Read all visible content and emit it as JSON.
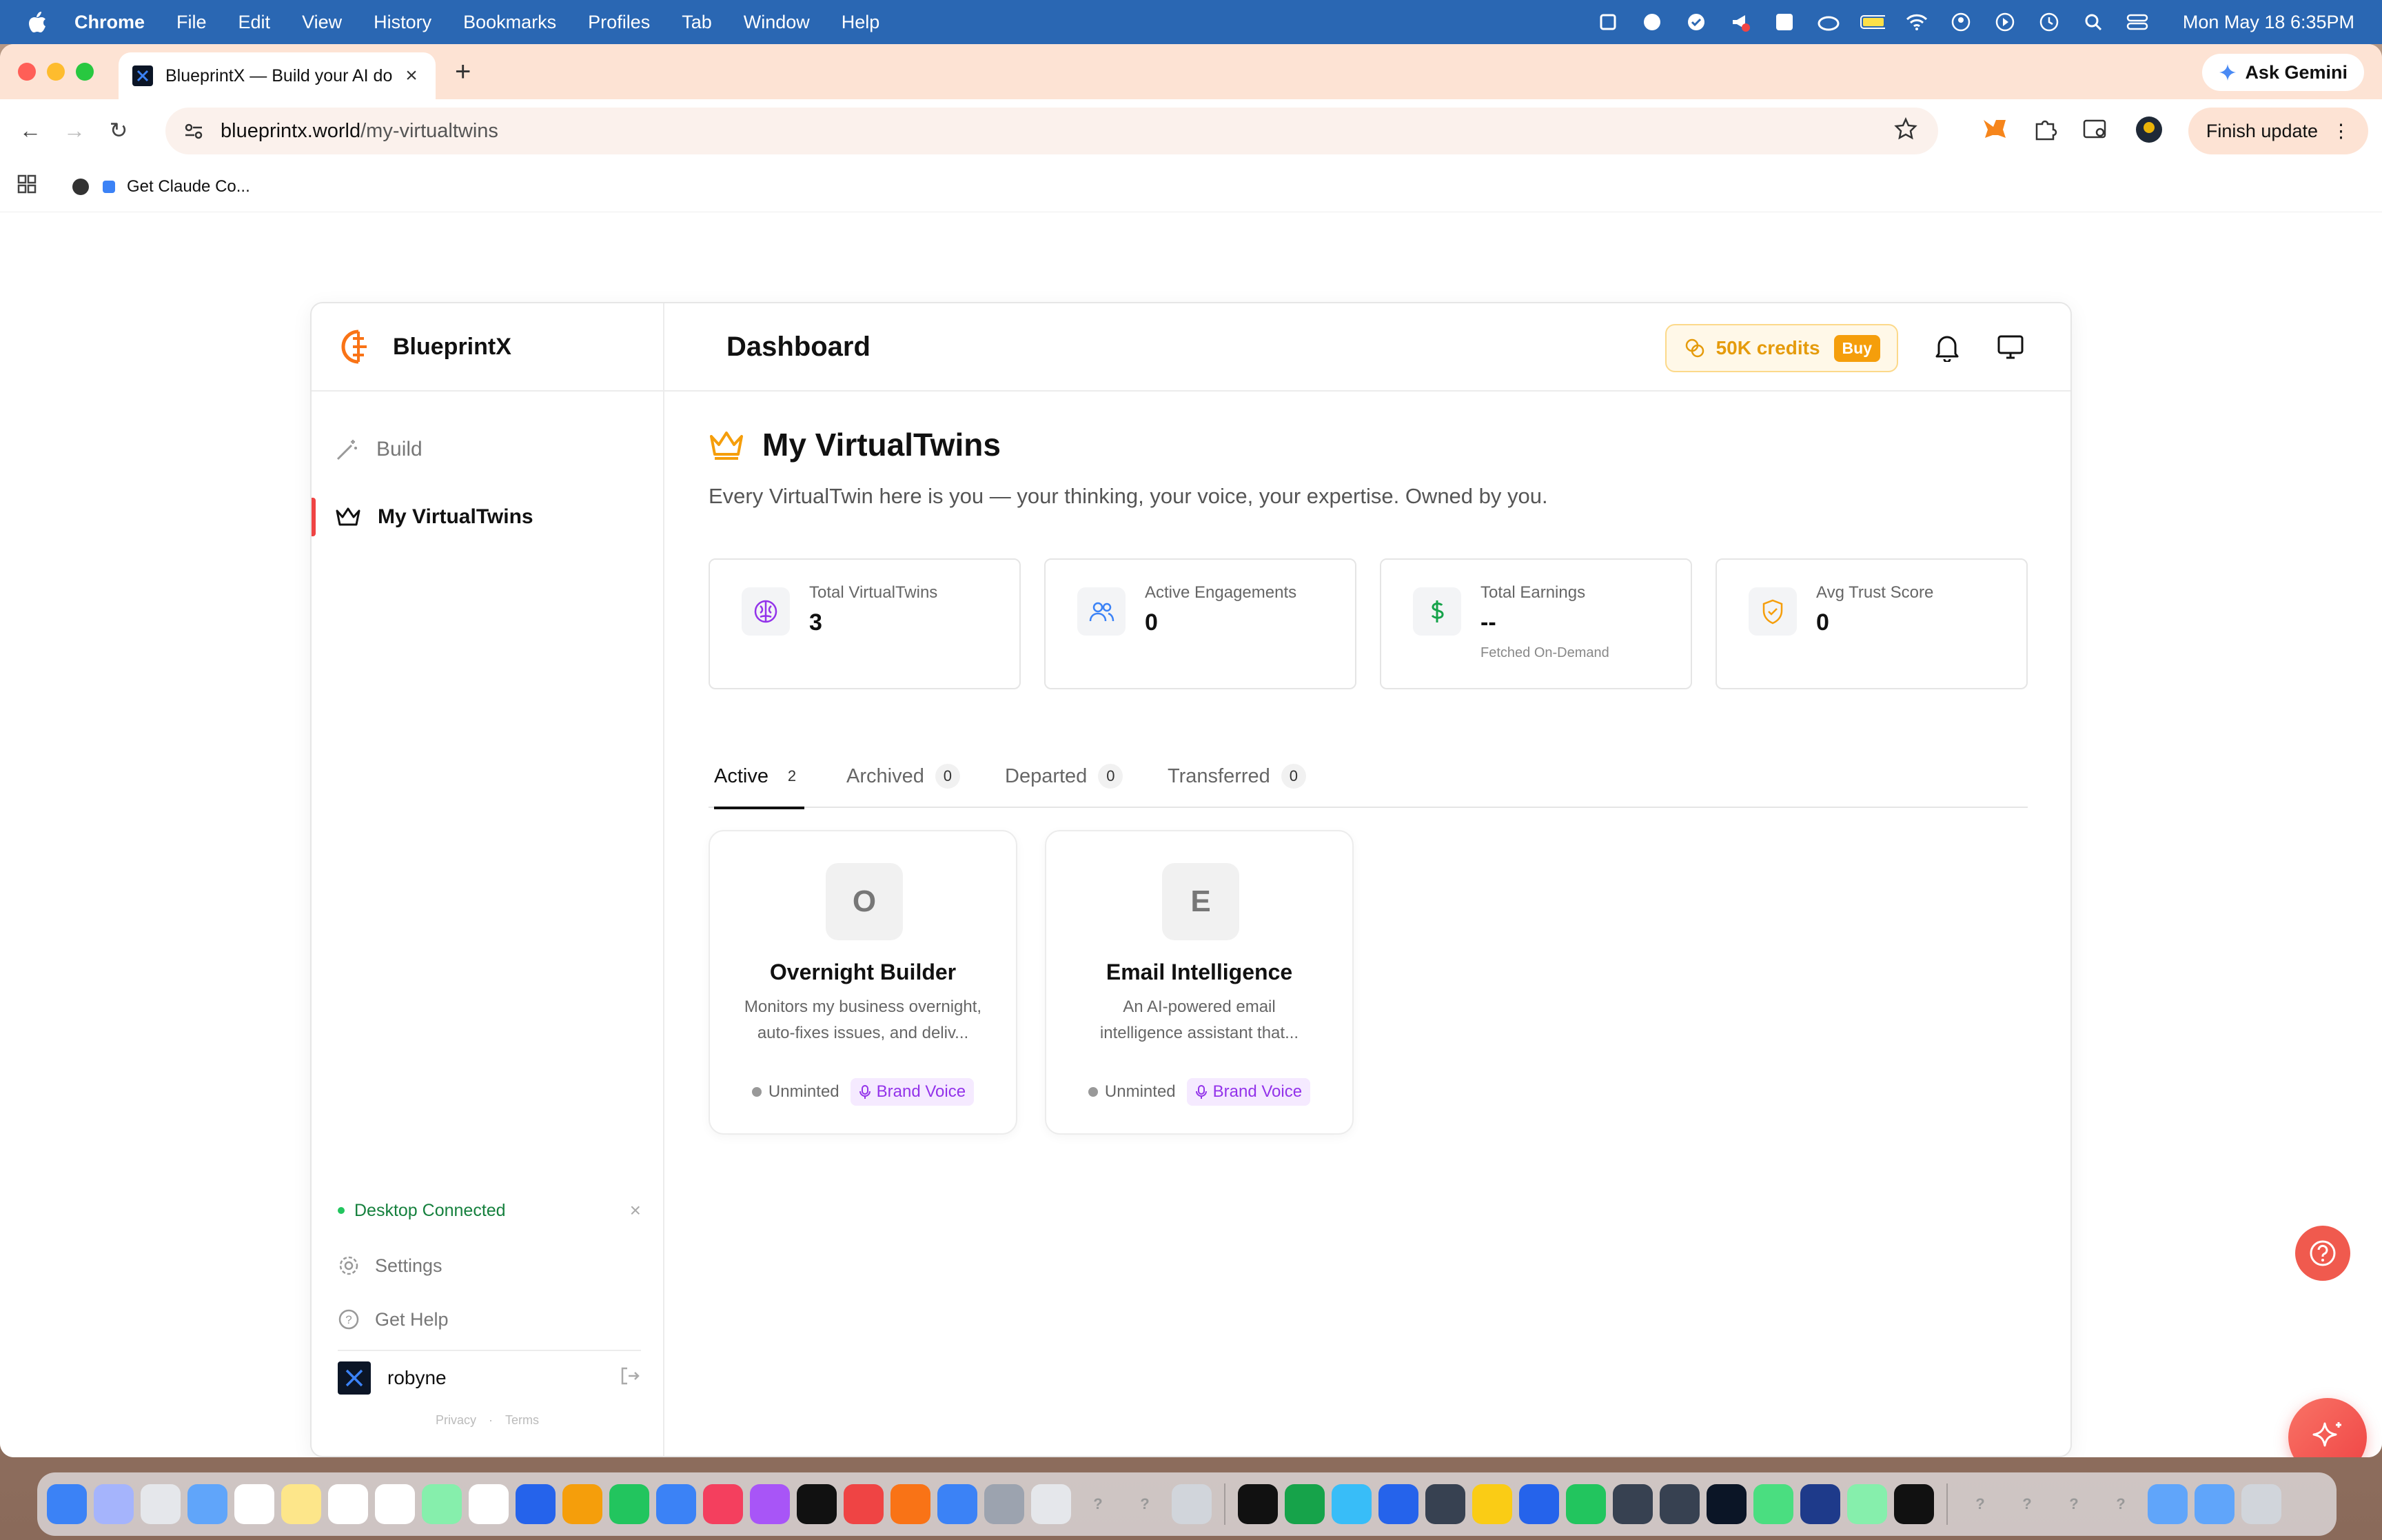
{
  "menubar": {
    "app": "Chrome",
    "items": [
      "File",
      "Edit",
      "View",
      "History",
      "Bookmarks",
      "Profiles",
      "Tab",
      "Window",
      "Help"
    ],
    "clock": "Mon May 18  6:35PM"
  },
  "browser": {
    "tab_title": "BlueprintX — Build your AI do",
    "ask_gemini": "Ask Gemini",
    "url_host": "blueprintx.world",
    "url_path": "/my-virtualtwins",
    "finish_update": "Finish update",
    "bookmark": "Get Claude Co..."
  },
  "app": {
    "brand": "BlueprintX",
    "header_title": "Dashboard",
    "credits": "50K credits",
    "buy": "Buy",
    "colors": {
      "accent": "#ef4444",
      "credits": "#f59e0b",
      "brand_voice": "#9333ea",
      "connected": "#22c55e"
    }
  },
  "sidebar": {
    "items": [
      {
        "label": "Build",
        "icon": "magic-wand-icon"
      },
      {
        "label": "My VirtualTwins",
        "icon": "crown-icon"
      }
    ],
    "desktop_status": "Desktop Connected",
    "settings": "Settings",
    "get_help": "Get Help",
    "user": "robyne",
    "privacy": "Privacy",
    "terms": "Terms"
  },
  "page": {
    "title": "My VirtualTwins",
    "subtitle": "Every VirtualTwin here is you — your thinking, your voice, your expertise. Owned by you."
  },
  "stats": [
    {
      "label": "Total VirtualTwins",
      "value": "3",
      "note": "",
      "icon": "brain-icon"
    },
    {
      "label": "Active Engagements",
      "value": "0",
      "note": "",
      "icon": "users-icon"
    },
    {
      "label": "Total Earnings",
      "value": "--",
      "note": "Fetched On-Demand",
      "icon": "dollar-icon"
    },
    {
      "label": "Avg Trust Score",
      "value": "0",
      "note": "",
      "icon": "shield-check-icon"
    }
  ],
  "tabs": [
    {
      "label": "Active",
      "count": "2"
    },
    {
      "label": "Archived",
      "count": "0"
    },
    {
      "label": "Departed",
      "count": "0"
    },
    {
      "label": "Transferred",
      "count": "0"
    }
  ],
  "twins": [
    {
      "initial": "O",
      "name": "Overnight Builder",
      "desc1": "Monitors my business overnight,",
      "desc2": "auto-fixes issues, and deliv...",
      "status": "Unminted",
      "tag": "Brand Voice"
    },
    {
      "initial": "E",
      "name": "Email Intelligence",
      "desc1": "An AI-powered email",
      "desc2": "intelligence assistant that...",
      "status": "Unminted",
      "tag": "Brand Voice"
    }
  ]
}
